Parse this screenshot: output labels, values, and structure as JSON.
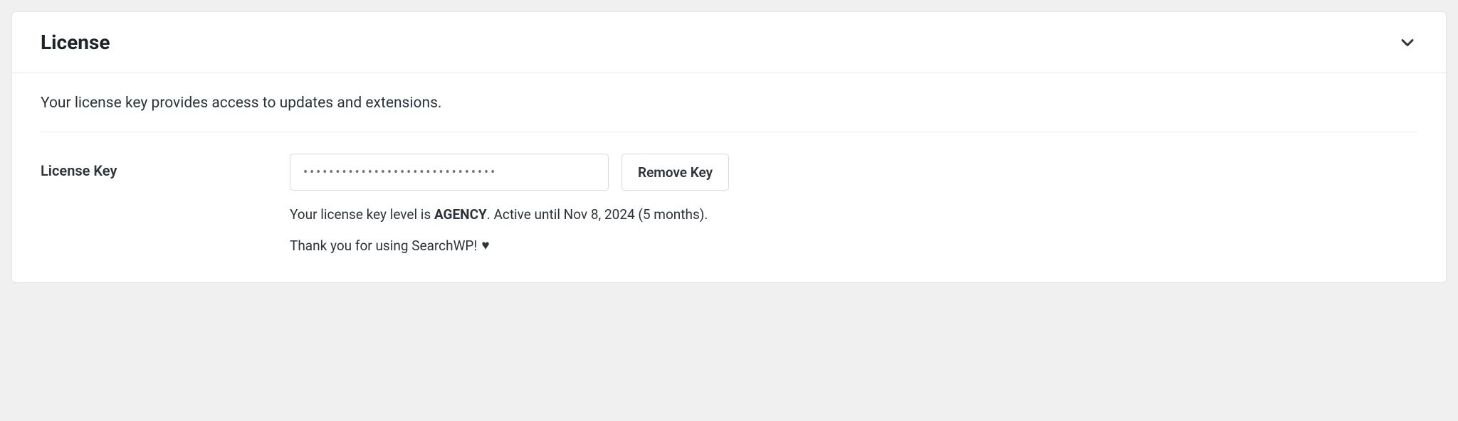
{
  "panel": {
    "title": "License",
    "intro": "Your license key provides access to updates and extensions.",
    "field_label": "License Key",
    "input_value": "••••••••••••••••••••••••••••••",
    "input_placeholder": "",
    "remove_button": "Remove Key",
    "status_prefix": "Your license key level is ",
    "level": "AGENCY",
    "status_suffix": ". Active until Nov 8, 2024 (5 months).",
    "thankyou": "Thank you for using SearchWP! ",
    "heart": "♥"
  }
}
